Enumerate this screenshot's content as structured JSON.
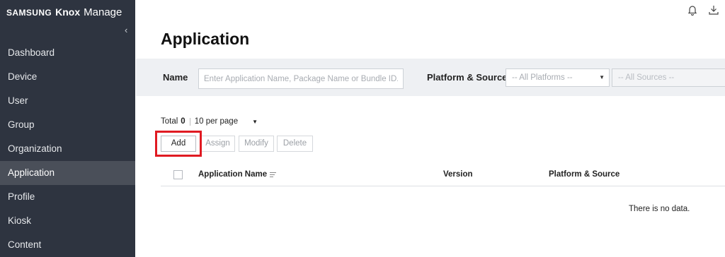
{
  "brand": {
    "samsung": "SAMSUNG",
    "knox": "Knox",
    "manage": "Manage"
  },
  "sidebar": {
    "items": [
      {
        "label": "Dashboard"
      },
      {
        "label": "Device"
      },
      {
        "label": "User"
      },
      {
        "label": "Group"
      },
      {
        "label": "Organization"
      },
      {
        "label": "Application",
        "active": true
      },
      {
        "label": "Profile"
      },
      {
        "label": "Kiosk"
      },
      {
        "label": "Content"
      }
    ]
  },
  "header": {
    "icons": [
      "bell-icon",
      "download-icon"
    ]
  },
  "page": {
    "title": "Application"
  },
  "filters": {
    "name_label": "Name",
    "name_placeholder": "Enter Application Name, Package Name or Bundle ID.",
    "platform_source_label": "Platform & Source",
    "platforms_selected": "-- All Platforms --",
    "sources_selected": "-- All Sources --"
  },
  "toolbar": {
    "total_label": "Total",
    "total_count": "0",
    "per_page": "10 per page",
    "add_label": "Add",
    "assign_label": "Assign",
    "modify_label": "Modify",
    "delete_label": "Delete"
  },
  "table": {
    "columns": [
      "Application Name",
      "Version",
      "Platform & Source"
    ],
    "empty_text": "There is no data."
  },
  "colors": {
    "sidebar_bg": "#2e3440",
    "active_item": "#4a4f59",
    "highlight": "#e01a22",
    "filter_bg": "#eef0f3"
  }
}
